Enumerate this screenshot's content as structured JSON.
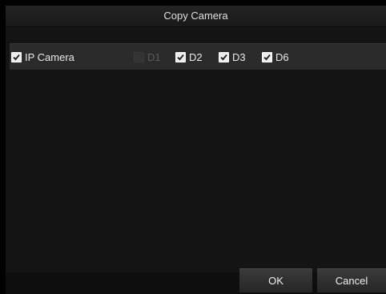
{
  "dialog": {
    "title": "Copy Camera",
    "ok_label": "OK",
    "cancel_label": "Cancel"
  },
  "camera_row": {
    "group": {
      "label": "IP Camera",
      "checked": true
    },
    "channels": [
      {
        "label": "D1",
        "checked": false,
        "disabled": true
      },
      {
        "label": "D2",
        "checked": true,
        "disabled": false
      },
      {
        "label": "D3",
        "checked": true,
        "disabled": false
      },
      {
        "label": "D6",
        "checked": true,
        "disabled": false
      }
    ]
  },
  "colors": {
    "background": "#000000",
    "panel": "#141414",
    "row": "#2b2b2b",
    "text": "#eaeaea",
    "disabled_text": "#5a5a5a"
  }
}
